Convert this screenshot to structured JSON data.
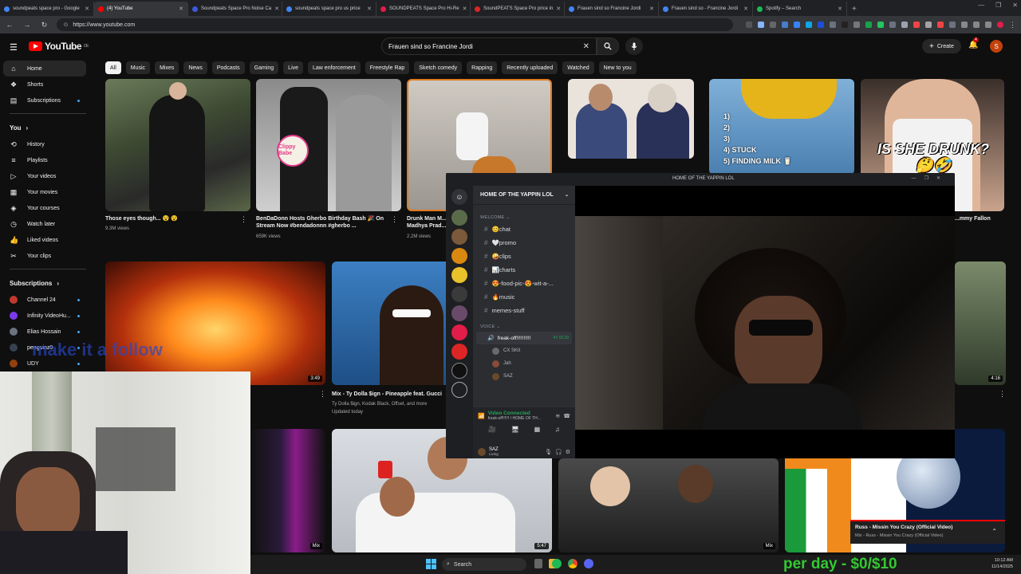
{
  "browser": {
    "tabs": [
      {
        "label": "soundpeats space pro - Google",
        "fav": "#4285f4",
        "active": false
      },
      {
        "label": "(4) YouTube",
        "fav": "#ff0000",
        "active": true
      },
      {
        "label": "Soundpeats Space Pro Noise Ca",
        "fav": "#3b5bdb",
        "active": false
      },
      {
        "label": "soundpeats space pro us price",
        "fav": "#4285f4",
        "active": false
      },
      {
        "label": "SOUNDPEATS Space Pro Hi-Re",
        "fav": "#e11d48",
        "active": false
      },
      {
        "label": "SoundPEATS Space Pro price in",
        "fav": "#dc2626",
        "active": false
      },
      {
        "label": "Frauen sind so Francine Jordi",
        "fav": "#4285f4",
        "active": false
      },
      {
        "label": "Frauen sind so - Francine Jordi",
        "fav": "#4285f4",
        "active": false
      },
      {
        "label": "Spotify – Search",
        "fav": "#1db954",
        "active": false
      }
    ],
    "url": "https://www.youtube.com"
  },
  "youtube": {
    "logo_text": "YouTube",
    "logo_region": "DE",
    "search_value": "Frauen sind so Francine Jordi",
    "create_label": "Create",
    "notification_count": "4",
    "avatar_letter": "S",
    "chips": [
      "All",
      "Music",
      "Mixes",
      "News",
      "Podcasts",
      "Gaming",
      "Live",
      "Law enforcement",
      "Freestyle Rap",
      "Sketch comedy",
      "Rapping",
      "Recently uploaded",
      "Watched",
      "New to you"
    ],
    "sidebar": {
      "main": [
        {
          "label": "Home",
          "icon": "home-icon"
        },
        {
          "label": "Shorts",
          "icon": "shorts-icon"
        },
        {
          "label": "Subscriptions",
          "icon": "subscriptions-icon"
        }
      ],
      "you_header": "You",
      "you": [
        {
          "label": "History",
          "icon": "history-icon"
        },
        {
          "label": "Playlists",
          "icon": "playlists-icon"
        },
        {
          "label": "Your videos",
          "icon": "your-videos-icon"
        },
        {
          "label": "Your movies",
          "icon": "movies-icon"
        },
        {
          "label": "Your courses",
          "icon": "courses-icon"
        },
        {
          "label": "Watch later",
          "icon": "watch-later-icon"
        },
        {
          "label": "Liked videos",
          "icon": "like-icon"
        },
        {
          "label": "Your clips",
          "icon": "scissors-icon"
        }
      ],
      "subs_header": "Subscriptions",
      "subs": [
        {
          "label": "Channel 24",
          "color": "#c0392b"
        },
        {
          "label": "Infinity VideoHu...",
          "color": "#7c3aed"
        },
        {
          "label": "Elias Hossain",
          "color": "#6b7280"
        },
        {
          "label": "penguinz0",
          "color": "#374151"
        },
        {
          "label": "UDY",
          "color": "#92400e"
        }
      ]
    },
    "videos_row1": [
      {
        "title": "Those eyes though... 😵 😵",
        "meta": "9.3M views"
      },
      {
        "title": "BenDaDonn Hosts Gherbo Birthday Bash 🎉 On Stream Now #bendadonnn #gherbo ...",
        "meta": "659K views"
      },
      {
        "title": "Drunk Man M... Madhya Prad...",
        "meta": "2.2M views"
      },
      {
        "title": "...mmy Fallon",
        "meta": ""
      }
    ],
    "thumb_texts": {
      "stuck": [
        "1)",
        "2)",
        "3)",
        "4) STUCK",
        "5) FINDING MILK 🥛"
      ],
      "drunk": "IS SHE DRUNK? 🤔🤣",
      "clippy": "Clippy Babe"
    },
    "videos_row2": [
      {
        "title": "",
        "meta": "",
        "duration": "3:49"
      },
      {
        "title": "Mix - Ty Dolla $ign - Pineapple feat. Gucci",
        "meta": "Ty Dolla $ign, Kodak Black, Offset, and more",
        "meta2": "Updated today"
      },
      {
        "title": "",
        "meta": "",
        "duration": "4:16"
      }
    ],
    "row3_badges": [
      "Mix",
      "5:47",
      "Mix"
    ],
    "miniplayer": {
      "title": "Russ - Missin You Crazy (Official Video)",
      "subtitle": "Mix - Russ - Missin You Crazy (Official Video)"
    }
  },
  "discord": {
    "window_title": "HOME OF THE YAPPIN LOL",
    "server_name": "HOME OF THE YAPPIN LOL",
    "cat_welcome": "Welcome",
    "channels": [
      "😊chat",
      "🤍promo",
      "🤪clips",
      "📊charts",
      "😍-food-pic-😍-wit-a-...",
      "🔥music",
      "memes-stuff"
    ],
    "cat_voice": "Voice",
    "voice_channel": "freak-off!!!!!!!!!!",
    "voice_time": "47:16:29",
    "voice_members": [
      "CX SKII",
      "Jah",
      "SAZ"
    ],
    "video_connected": "Video Connected",
    "vc_path": "freak-off!!!!!! / HOME OF TH...",
    "user_name": "SAZ",
    "user_status": "Living"
  },
  "webcam_overlay": "make it a follow",
  "taskbar": {
    "search": "Search",
    "time": "10:12 AM",
    "date": "11/14/2025"
  },
  "stream_overlay": "per day - $0/$10"
}
